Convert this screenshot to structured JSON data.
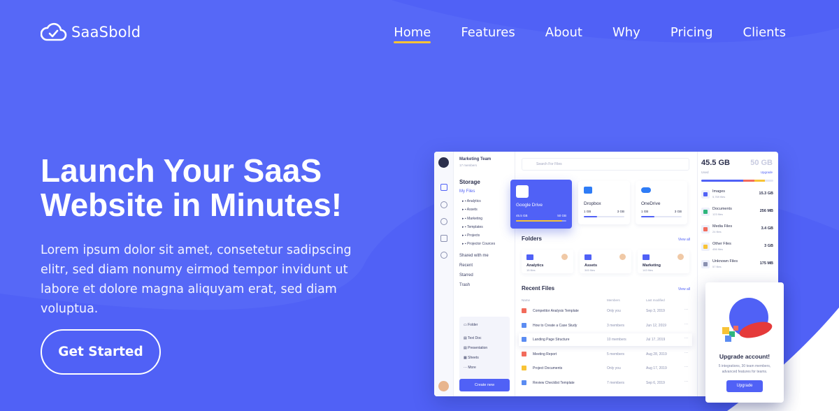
{
  "brand": {
    "name": "SaaSbold"
  },
  "nav": {
    "items": [
      "Home",
      "Features",
      "About",
      "Why",
      "Pricing",
      "Clients"
    ],
    "active": "Home"
  },
  "hero": {
    "title": "Launch Your SaaS Website in Minutes!",
    "description": "Lorem ipsum dolor sit amet, consetetur sadipscing elitr, sed diam nonumy eirmod tempor invidunt ut labore et dolore magna aliquyam erat, sed diam voluptua.",
    "cta": "Get Started"
  },
  "dashboard": {
    "team": "Marketing Team",
    "team_members": "17 members",
    "search_placeholder": "Search For Files",
    "storage_title": "Storage",
    "my_files": "My Files",
    "tree": [
      "Analytics",
      "Assets",
      "Marketing",
      "Templates",
      "Projects",
      "Projector Cources"
    ],
    "links": [
      "Shared with me",
      "Recent",
      "Starred",
      "Trash"
    ],
    "bottom_items": [
      "Folder",
      "Text Doc",
      "Presentation",
      "Sheets",
      "More"
    ],
    "create_new": "Create new",
    "clouds": [
      {
        "name": "Google Drive",
        "used": "45.5 GB",
        "total": "50 GB",
        "fill": 0.91
      },
      {
        "name": "Dropbox",
        "used": "1 GB",
        "total": "3 GB",
        "fill": 0.33
      },
      {
        "name": "OneDrive",
        "used": "1 GB",
        "total": "3 GB",
        "fill": 0.33
      }
    ],
    "folders_title": "Folders",
    "view_all": "View all",
    "folders": [
      {
        "name": "Analytics",
        "count": "15 files"
      },
      {
        "name": "Assets",
        "count": "345 files"
      },
      {
        "name": "Marketing",
        "count": "143 files"
      }
    ],
    "recent_title": "Recent Files",
    "columns": [
      "Name",
      "Members",
      "Last modified"
    ],
    "recent_files": [
      {
        "name": "Competitor Analysis Template",
        "members": "Only you",
        "date": "Sep 3, 2019",
        "color": "#f26b5b"
      },
      {
        "name": "How to Create a Case Study",
        "members": "3 members",
        "date": "Jun 12, 2019",
        "color": "#5b8cf2"
      },
      {
        "name": "Landing Page Structure",
        "members": "10 members",
        "date": "Jul 17, 2019",
        "color": "#5b8cf2"
      },
      {
        "name": "Meeting Report",
        "members": "5 members",
        "date": "Aug 28, 2019",
        "color": "#f26b5b"
      },
      {
        "name": "Project Documents",
        "members": "Only you",
        "date": "Aug 17, 2019",
        "color": "#f8c336"
      },
      {
        "name": "Review Checklist Template",
        "members": "7 members",
        "date": "Sep 6, 2019",
        "color": "#5b8cf2"
      }
    ],
    "storage_used": "45.5 GB",
    "storage_total": "50 GB",
    "used_label": "Used",
    "upgrade_link": "Upgrade",
    "file_types": [
      {
        "name": "Images",
        "count": "5,769 files",
        "size": "15.3 GB",
        "color": "#5061f6"
      },
      {
        "name": "Documents",
        "count": "123 files",
        "size": "256 MB",
        "color": "#2fb67c"
      },
      {
        "name": "Media Files",
        "count": "24 files",
        "size": "3.4 GB",
        "color": "#f26b5b"
      },
      {
        "name": "Other Files",
        "count": "456 files",
        "size": "3 GB",
        "color": "#f8c336"
      },
      {
        "name": "Unknown Files",
        "count": "57 files",
        "size": "175 MB",
        "color": "#8a90b0"
      }
    ]
  },
  "upgrade": {
    "title": "Upgrade account!",
    "description": "5 integrations, 30 team members, advanced features for teams.",
    "button": "Upgrade"
  }
}
